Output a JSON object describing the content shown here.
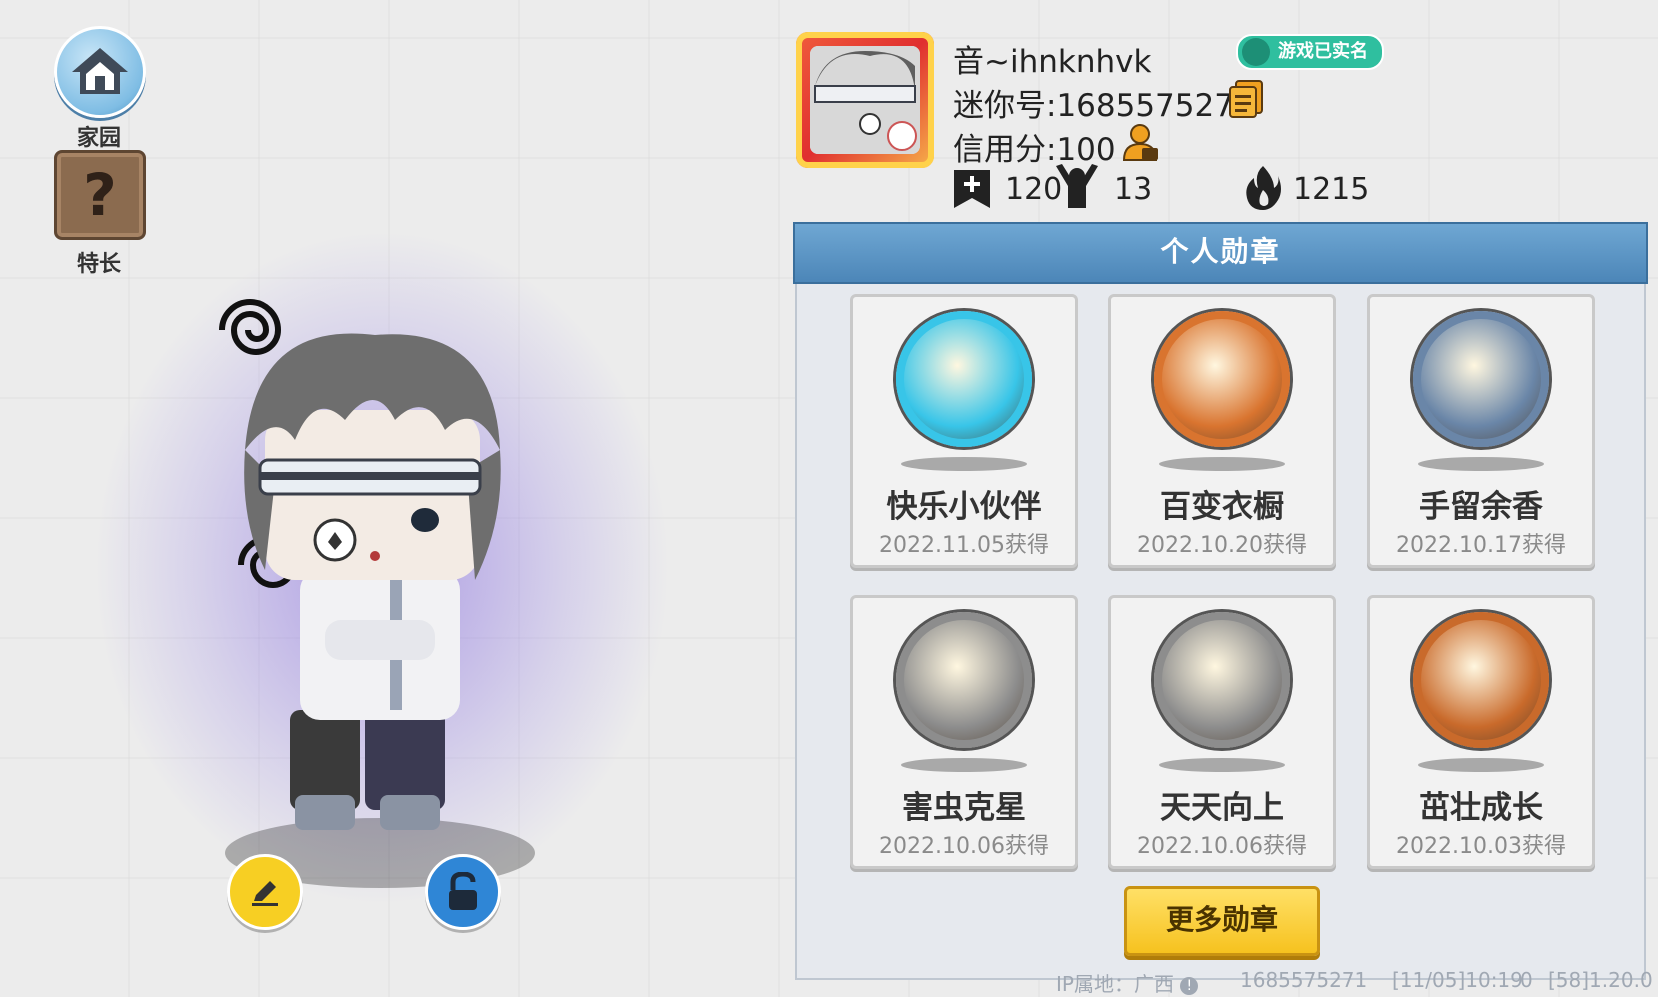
{
  "nav": {
    "home_label": "家园",
    "skill_label": "特长"
  },
  "profile": {
    "name": "音~ihnknhvk",
    "verified_label": "游戏已实名",
    "mini_id": "迷你号:1685575271",
    "credit": "信用分:100",
    "stats": {
      "add_count": "120",
      "fans_count": "13",
      "heat_count": "1215"
    }
  },
  "medals": {
    "title": "个人勋章",
    "items": [
      {
        "name": "快乐小伙伴",
        "date": "2022.11.05获得",
        "icon": "friends-medal-icon",
        "color": "#38c5e8"
      },
      {
        "name": "百变衣橱",
        "date": "2022.10.20获得",
        "icon": "wardrobe-medal-icon",
        "color": "#d9742f"
      },
      {
        "name": "手留余香",
        "date": "2022.10.17获得",
        "icon": "fragrance-medal-icon",
        "color": "#6a86a8"
      },
      {
        "name": "害虫克星",
        "date": "2022.10.06获得",
        "icon": "pest-medal-icon",
        "color": "#8d8d8d"
      },
      {
        "name": "天天向上",
        "date": "2022.10.06获得",
        "icon": "progress-medal-icon",
        "color": "#8d8d8d"
      },
      {
        "name": "茁壮成长",
        "date": "2022.10.03获得",
        "icon": "growth-medal-icon",
        "color": "#c96a2b"
      }
    ],
    "more_label": "更多勋章"
  },
  "footer": {
    "ip": "IP属地：广西",
    "id": "1685575271",
    "time": "[11/05]10:19",
    "zero": "0",
    "version": "[58]1.20.0"
  }
}
